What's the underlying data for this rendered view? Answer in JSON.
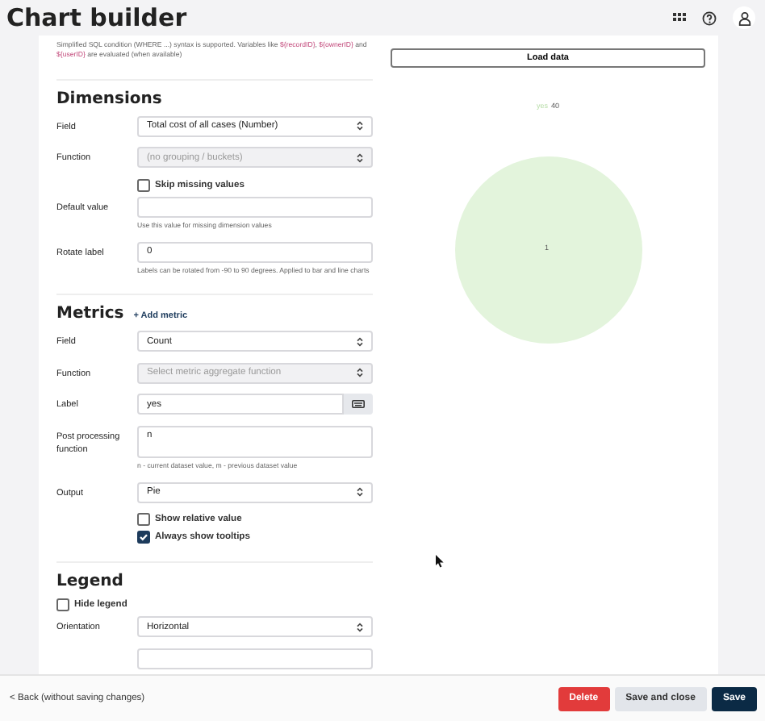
{
  "header": {
    "title": "Chart builder"
  },
  "filter_help": [
    {
      "text": "Simplified SQL condition (WHERE ...) syntax is supported. Variables like ",
      "kind": "plain"
    },
    {
      "text": "${recordID}",
      "kind": "code"
    },
    {
      "text": ", ",
      "kind": "plain"
    },
    {
      "text": "${ownerID}",
      "kind": "code"
    },
    {
      "text": " and ",
      "kind": "plain"
    },
    {
      "text": "${userID}",
      "kind": "code"
    },
    {
      "text": " are evaluated (when available)",
      "kind": "plain"
    }
  ],
  "dimensions": {
    "heading": "Dimensions",
    "rows": [
      {
        "kind": "select",
        "label": "Field",
        "value": "Total cost of all cases (Number)",
        "disabled": false
      },
      {
        "kind": "select",
        "label": "Function",
        "placeholder": "(no grouping / buckets)",
        "disabled": true
      },
      {
        "kind": "checkbox",
        "label": "Skip missing values",
        "checked": false
      },
      {
        "kind": "input",
        "label": "Default value",
        "value": "",
        "help": "Use this value for missing dimension values"
      },
      {
        "kind": "input",
        "label": "Rotate label",
        "value": "0",
        "help": "Labels can be rotated from -90 to 90 degrees. Applied to bar and line charts"
      }
    ]
  },
  "metrics": {
    "heading": "Metrics",
    "add_link": "+ Add metric",
    "rows": [
      {
        "kind": "select",
        "label": "Field",
        "value": "Count",
        "disabled": false
      },
      {
        "kind": "select",
        "label": "Function",
        "placeholder": "Select metric aggregate function",
        "disabled": true
      },
      {
        "kind": "label",
        "label": "Label",
        "value": "yes"
      },
      {
        "kind": "textarea",
        "label": "Post processing function",
        "value": "n",
        "help": "n - current dataset value, m - previous dataset value"
      },
      {
        "kind": "select",
        "label": "Output",
        "value": "Pie",
        "disabled": false
      },
      {
        "kind": "checkbox",
        "label": "Show relative value",
        "checked": false
      },
      {
        "kind": "checkbox",
        "label": "Always show tooltips",
        "checked": true
      }
    ]
  },
  "legend": {
    "heading": "Legend",
    "rows": [
      {
        "kind": "checkbox-left",
        "label": "Hide legend",
        "checked": false
      },
      {
        "kind": "select",
        "label": "Orientation",
        "value": "Horizontal",
        "disabled": false
      }
    ]
  },
  "preview": {
    "load_button": "Load data",
    "legend_label": "yes",
    "legend_value": "40",
    "slice_label": "1"
  },
  "footer": {
    "back": "< Back (without saving changes)",
    "buttons": [
      {
        "label": "Delete",
        "kind": "danger"
      },
      {
        "label": "Save and close",
        "kind": "light"
      },
      {
        "label": "Save",
        "kind": "primary"
      }
    ]
  }
}
